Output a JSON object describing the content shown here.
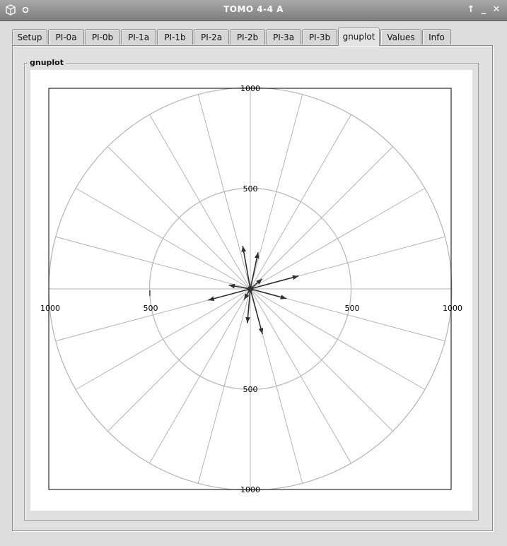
{
  "window": {
    "title": "TOMO 4-4 A",
    "left_icons": [
      "cube-icon",
      "circle-icon"
    ],
    "right_buttons": [
      {
        "name": "up-arrow-button",
        "glyph": "↑"
      },
      {
        "name": "minimize-button",
        "glyph": "_"
      },
      {
        "name": "close-button",
        "glyph": "✕"
      }
    ]
  },
  "tabs": [
    {
      "label": "Setup",
      "active": false
    },
    {
      "label": "PI-0a",
      "active": false
    },
    {
      "label": "PI-0b",
      "active": false
    },
    {
      "label": "PI-1a",
      "active": false
    },
    {
      "label": "PI-1b",
      "active": false
    },
    {
      "label": "PI-2a",
      "active": false
    },
    {
      "label": "PI-2b",
      "active": false
    },
    {
      "label": "PI-3a",
      "active": false
    },
    {
      "label": "PI-3b",
      "active": false
    },
    {
      "label": "gnuplot",
      "active": true
    },
    {
      "label": "Values",
      "active": false
    },
    {
      "label": "Info",
      "active": false
    }
  ],
  "groupbox": {
    "title": "gnuplot"
  },
  "plot": {
    "radial_max": 1000,
    "circle_radii": [
      500,
      1000
    ],
    "spoke_count": 24,
    "tick_labels": {
      "top_outer": "1000",
      "top_inner": "500",
      "bottom_inner": "500",
      "bottom_outer": "1000",
      "left_outer": "1000",
      "left_inner": "500",
      "right_inner": "500",
      "right_outer": "1000"
    },
    "grid_color": "#b4b4b4",
    "arrow_color": "#303030",
    "vectors": [
      {
        "angle_deg": 100,
        "magnitude": 140
      },
      {
        "angle_deg": 78,
        "magnitude": 120
      },
      {
        "angle_deg": 15,
        "magnitude": 160
      },
      {
        "angle_deg": -15,
        "magnitude": 120
      },
      {
        "angle_deg": -75,
        "magnitude": 150
      },
      {
        "angle_deg": -95,
        "magnitude": 110
      },
      {
        "angle_deg": -165,
        "magnitude": 140
      },
      {
        "angle_deg": 170,
        "magnitude": 70
      },
      {
        "angle_deg": 40,
        "magnitude": 50
      },
      {
        "angle_deg": -120,
        "magnitude": 40
      }
    ]
  }
}
